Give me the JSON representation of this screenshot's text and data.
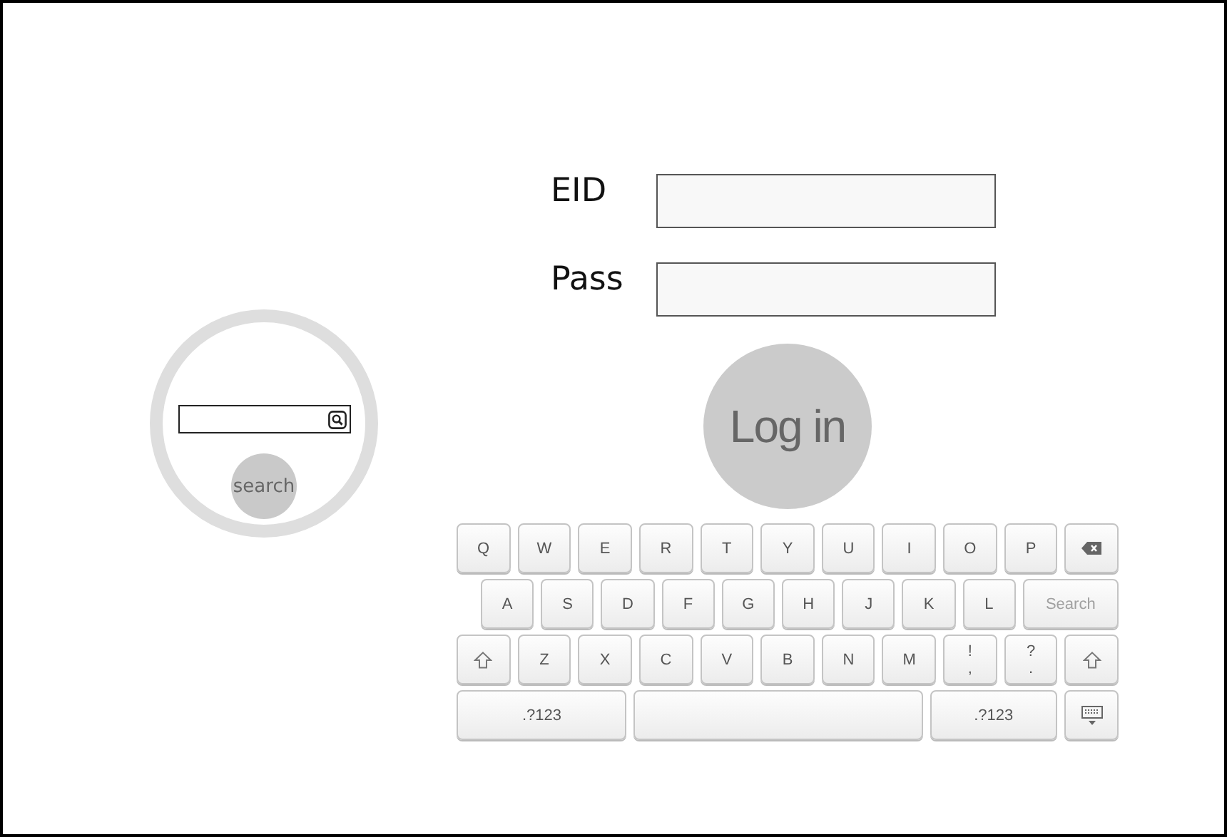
{
  "login": {
    "fields": [
      {
        "label": "EID"
      },
      {
        "label": "Pass"
      }
    ],
    "button": "Log in"
  },
  "search_widget": {
    "button": "search"
  },
  "keyboard": {
    "rows": [
      {
        "keys": [
          {
            "kind": "letter",
            "label": "Q"
          },
          {
            "kind": "letter",
            "label": "W"
          },
          {
            "kind": "letter",
            "label": "E"
          },
          {
            "kind": "letter",
            "label": "R"
          },
          {
            "kind": "letter",
            "label": "T"
          },
          {
            "kind": "letter",
            "label": "Y"
          },
          {
            "kind": "letter",
            "label": "U"
          },
          {
            "kind": "letter",
            "label": "I"
          },
          {
            "kind": "letter",
            "label": "O"
          },
          {
            "kind": "letter",
            "label": "P"
          },
          {
            "kind": "backspace"
          }
        ]
      },
      {
        "keys": [
          {
            "kind": "letter",
            "label": "A"
          },
          {
            "kind": "letter",
            "label": "S"
          },
          {
            "kind": "letter",
            "label": "D"
          },
          {
            "kind": "letter",
            "label": "F"
          },
          {
            "kind": "letter",
            "label": "G"
          },
          {
            "kind": "letter",
            "label": "H"
          },
          {
            "kind": "letter",
            "label": "J"
          },
          {
            "kind": "letter",
            "label": "K"
          },
          {
            "kind": "letter",
            "label": "L"
          },
          {
            "kind": "search",
            "label": "Search"
          }
        ]
      },
      {
        "keys": [
          {
            "kind": "shift"
          },
          {
            "kind": "letter",
            "label": "Z"
          },
          {
            "kind": "letter",
            "label": "X"
          },
          {
            "kind": "letter",
            "label": "C"
          },
          {
            "kind": "letter",
            "label": "V"
          },
          {
            "kind": "letter",
            "label": "B"
          },
          {
            "kind": "letter",
            "label": "N"
          },
          {
            "kind": "letter",
            "label": "M"
          },
          {
            "kind": "dual",
            "top": "!",
            "bottom": ","
          },
          {
            "kind": "dual",
            "top": "?",
            "bottom": "."
          },
          {
            "kind": "shift"
          }
        ]
      },
      {
        "keys": [
          {
            "kind": "symbols",
            "label": ".?123"
          },
          {
            "kind": "space"
          },
          {
            "kind": "symbols",
            "label": ".?123"
          },
          {
            "kind": "hide"
          }
        ]
      }
    ]
  }
}
